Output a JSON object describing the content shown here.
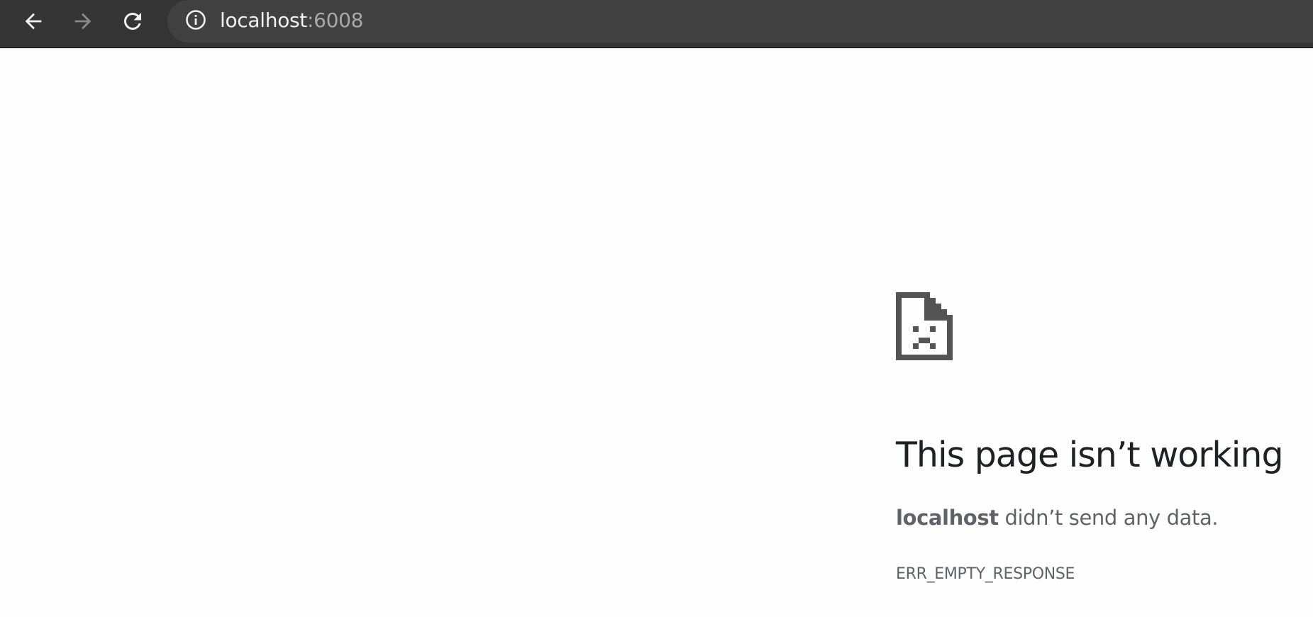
{
  "toolbar": {
    "back_icon": "arrow-left-icon",
    "forward_icon": "arrow-right-icon",
    "reload_icon": "reload-icon",
    "site_info_icon": "info-circle-icon",
    "url_host": "localhost",
    "url_port": ":6008",
    "background_color": "#353535",
    "omnibox_color": "#414141"
  },
  "error_page": {
    "icon": "sad-document-icon",
    "headline": "This page isn’t working",
    "host": "localhost",
    "message_rest": " didn’t send any data.",
    "error_code": "ERR_EMPTY_RESPONSE",
    "text_color": "#5f6368",
    "headline_color": "#202124"
  }
}
